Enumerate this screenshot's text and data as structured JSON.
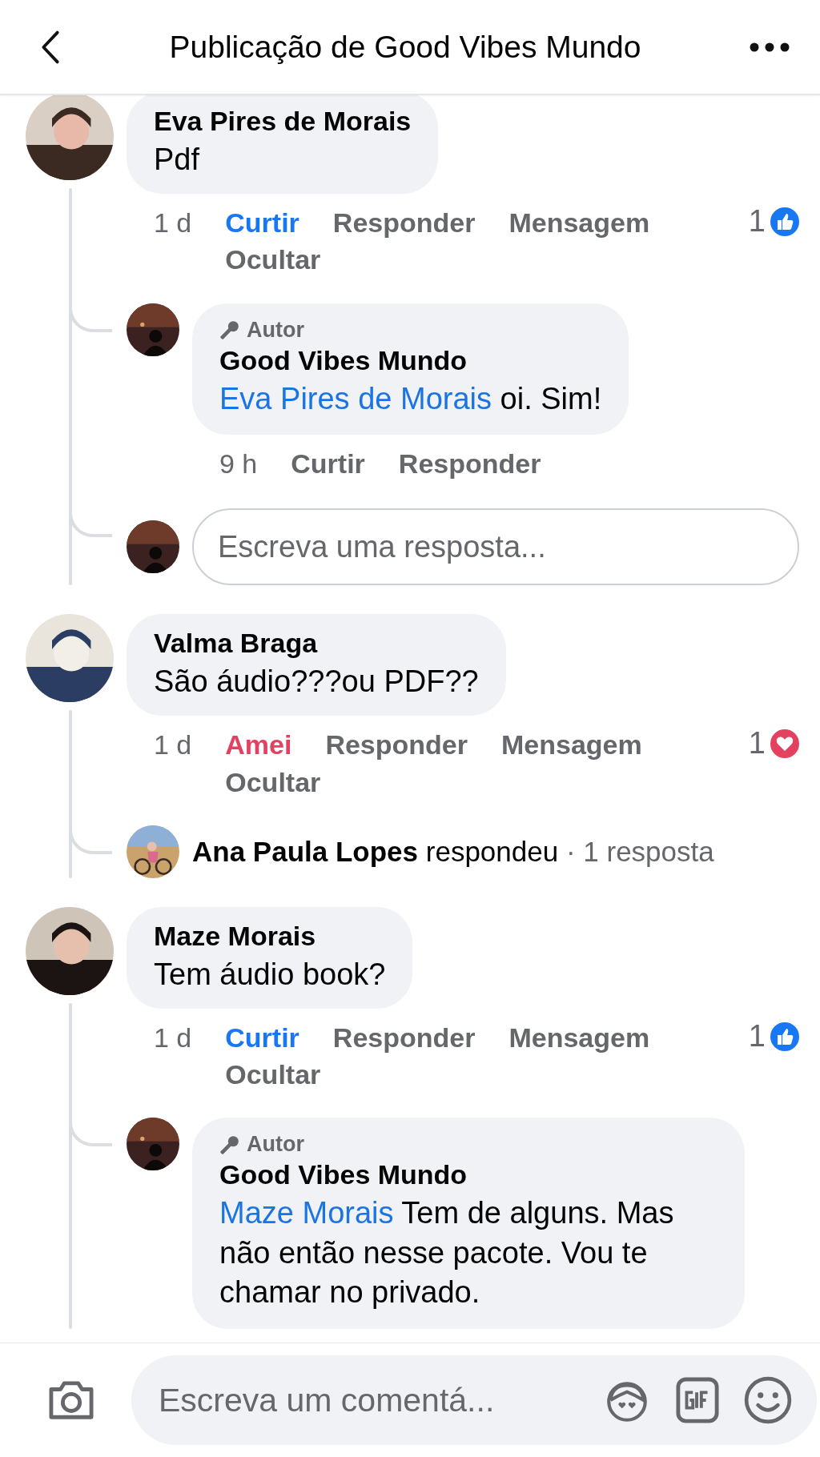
{
  "header": {
    "title": "Publicação de Good Vibes Mundo"
  },
  "comments": [
    {
      "author": "Eva Pires de Morais",
      "text": "Pdf",
      "time": "1 d",
      "my_reaction": {
        "kind": "like",
        "label": "Curtir"
      },
      "actions": [
        "Responder",
        "Mensagem",
        "Ocultar"
      ],
      "reactions": {
        "kind": "like",
        "count": "1"
      },
      "replies": [
        {
          "badge": "Autor",
          "author": "Good Vibes Mundo",
          "mention": "Eva Pires de Morais",
          "text": "oi. Sim!",
          "time": "9 h",
          "actions": [
            "Curtir",
            "Responder"
          ]
        }
      ],
      "reply_box": {
        "placeholder": "Escreva uma resposta..."
      }
    },
    {
      "author": "Valma Braga",
      "text": "São áudio???ou PDF??",
      "time": "1 d",
      "my_reaction": {
        "kind": "love",
        "label": "Amei"
      },
      "actions": [
        "Responder",
        "Mensagem",
        "Ocultar"
      ],
      "reactions": {
        "kind": "love",
        "count": "1"
      },
      "reply_summary": {
        "name": "Ana Paula Lopes",
        "verb": "respondeu",
        "count": "· 1 resposta"
      }
    },
    {
      "author": "Maze Morais",
      "text": "Tem áudio book?",
      "time": "1 d",
      "my_reaction": {
        "kind": "like",
        "label": "Curtir"
      },
      "actions": [
        "Responder",
        "Mensagem",
        "Ocultar"
      ],
      "reactions": {
        "kind": "like",
        "count": "1"
      },
      "replies": [
        {
          "badge": "Autor",
          "author": "Good Vibes Mundo",
          "mention": "Maze Morais",
          "text": "Tem de alguns. Mas não então nesse pacote. Vou te chamar no privado."
        }
      ]
    }
  ],
  "composer": {
    "placeholder": "Escreva um comentá..."
  }
}
